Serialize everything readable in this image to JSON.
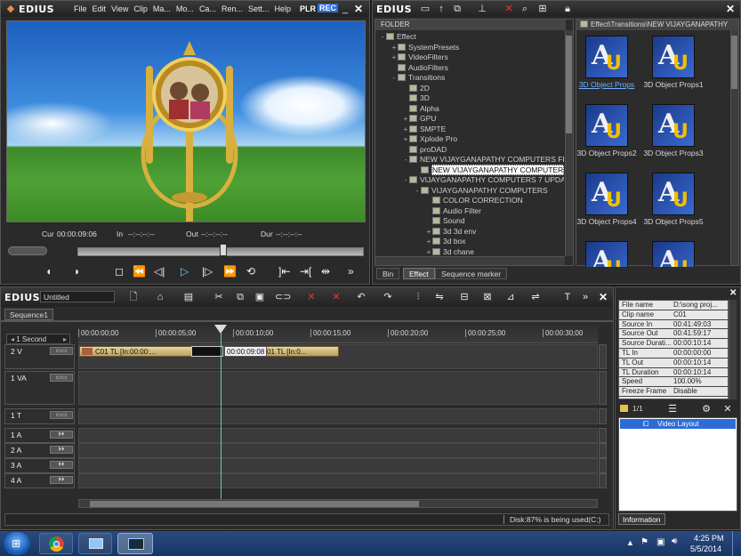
{
  "player": {
    "app": "EDIUS",
    "menu": [
      "File",
      "Edit",
      "View",
      "Clip",
      "Ma...",
      "Mo...",
      "Ca...",
      "Ren...",
      "Sett...",
      "Help"
    ],
    "plr": "PLR",
    "rec": "REC",
    "cur_label": "Cur",
    "cur_value": "00:00:09:06",
    "in_label": "In",
    "in_value": "--:--:--:--",
    "out_label": "Out",
    "out_value": "--:--:--:--",
    "dur_label": "Dur",
    "dur_value": "--:--:--:--"
  },
  "effect": {
    "app": "EDIUS",
    "folder_header": "FOLDER",
    "path": "Effect\\Transitions\\NEW VIJAYGANAPATHY",
    "tree": [
      {
        "label": "Effect",
        "indent": 0,
        "exp": "-"
      },
      {
        "label": "SystemPresets",
        "indent": 1,
        "exp": "+"
      },
      {
        "label": "VideoFilters",
        "indent": 1,
        "exp": "+"
      },
      {
        "label": "AudioFilters",
        "indent": 1,
        "exp": ""
      },
      {
        "label": "Transitions",
        "indent": 1,
        "exp": "-"
      },
      {
        "label": "2D",
        "indent": 2,
        "exp": ""
      },
      {
        "label": "3D",
        "indent": 2,
        "exp": ""
      },
      {
        "label": "Alpha",
        "indent": 2,
        "exp": ""
      },
      {
        "label": "GPU",
        "indent": 2,
        "exp": "+"
      },
      {
        "label": "SMPTE",
        "indent": 2,
        "exp": "+"
      },
      {
        "label": "Xplode Pro",
        "indent": 2,
        "exp": "+"
      },
      {
        "label": "proDAD",
        "indent": 2,
        "exp": ""
      },
      {
        "label": "NEW VIJAYGANAPATHY COMPUTERS FL",
        "indent": 2,
        "exp": "-"
      },
      {
        "label": "NEW VIJAYGANAPATHY COMPUTER",
        "indent": 3,
        "exp": "",
        "selected": true
      },
      {
        "label": "VIJAYGANAPATHY COMPUTERS 7 UPDA",
        "indent": 2,
        "exp": "-"
      },
      {
        "label": "VIJAYGANAPATHY COMPUTERS",
        "indent": 3,
        "exp": "-"
      },
      {
        "label": "COLOR CORRECTION",
        "indent": 4,
        "exp": ""
      },
      {
        "label": "Audio Filter",
        "indent": 4,
        "exp": ""
      },
      {
        "label": "Sound",
        "indent": 4,
        "exp": ""
      },
      {
        "label": "3d 3d env",
        "indent": 4,
        "exp": "+"
      },
      {
        "label": "3d box",
        "indent": 4,
        "exp": "+"
      },
      {
        "label": "3d chane",
        "indent": 4,
        "exp": "+"
      }
    ],
    "thumbs": [
      {
        "label": "3D Object Props"
      },
      {
        "label": "3D Object Props1"
      },
      {
        "label": "3D Object Props2"
      },
      {
        "label": "3D Object Props3"
      },
      {
        "label": "3D Object Props4"
      },
      {
        "label": "3D Object Props5"
      },
      {
        "label": ""
      },
      {
        "label": ""
      }
    ],
    "tabs": [
      "Bin",
      "Effect",
      "Sequence marker"
    ]
  },
  "timeline": {
    "app": "EDIUS",
    "project": "Untitled",
    "sequence_tab": "Sequence1",
    "scale": "1 Second",
    "ruler": [
      "00:00:00;00",
      "00:00:05;00",
      "00:00:10;00",
      "00:00:15;00",
      "00:00:20;00",
      "00:00:25;00",
      "00:00:30;00"
    ],
    "clip1": "C01  TL [In:00:00:...",
    "clip_tooltip": "00:00:09:08",
    "clip2": "01  TL [In:0...",
    "tracks": [
      {
        "name": "2 V",
        "type": "video"
      },
      {
        "name": "1 VA",
        "type": "va"
      },
      {
        "name": "1 T",
        "type": "title"
      },
      {
        "name": "1 A",
        "type": "audio"
      },
      {
        "name": "2 A",
        "type": "audio"
      },
      {
        "name": "3 A",
        "type": "audio"
      },
      {
        "name": "4 A",
        "type": "audio"
      }
    ],
    "status": "Disk:87% is being used(C:)"
  },
  "info": {
    "props": [
      {
        "k": "File name",
        "v": "D:\\song proj..."
      },
      {
        "k": "Clip name",
        "v": "C01"
      },
      {
        "k": "Source In",
        "v": "00:41:49:03"
      },
      {
        "k": "Source Out",
        "v": "00:41:59:17"
      },
      {
        "k": "Source Durati...",
        "v": "00:00:10:14"
      },
      {
        "k": "TL In",
        "v": "00:00:00:00"
      },
      {
        "k": "TL Out",
        "v": "00:00:10:14"
      },
      {
        "k": "TL Duration",
        "v": "00:00:10:14"
      },
      {
        "k": "Speed",
        "v": "100.00%"
      },
      {
        "k": "Freeze Frame",
        "v": "Disable"
      }
    ],
    "page": "1/1",
    "layout_item": "Video Layout",
    "tab": "Information"
  },
  "taskbar": {
    "time": "4:25 PM",
    "date": "5/5/2014"
  }
}
